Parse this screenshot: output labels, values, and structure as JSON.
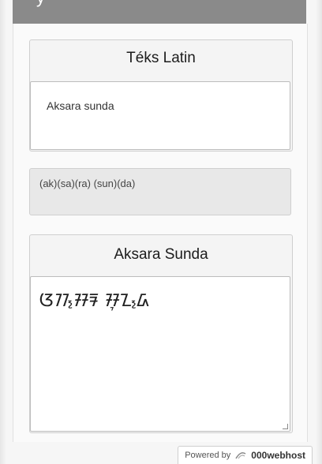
{
  "header": {
    "title": "y"
  },
  "latin": {
    "title": "Téks Latin",
    "input_value": "Aksara sunda"
  },
  "transliteration": {
    "text": "(ak)(sa)(ra) (sun)(da)"
  },
  "sunda": {
    "title": "Aksara Sunda",
    "output_text": "ᮃᮊ᮪ᮞᮛ ᮞᮥᮔ᮪ᮓ"
  },
  "footer": {
    "powered_by": "Powered by",
    "brand": "000webhost",
    "icon": "webhost-logo-icon"
  }
}
